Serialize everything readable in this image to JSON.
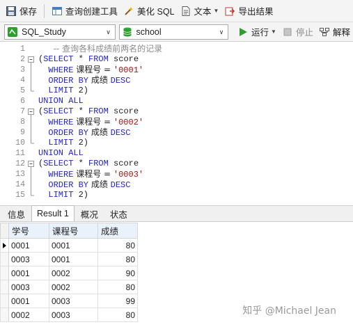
{
  "toolbar": {
    "save": "保存",
    "query_builder": "查询创建工具",
    "beautify_sql": "美化 SQL",
    "text": "文本",
    "export_results": "导出结果"
  },
  "connection_bar": {
    "connection": "SQL_Study",
    "database": "school",
    "run": "运行",
    "stop": "停止",
    "explain": "解释"
  },
  "editor": {
    "lines": [
      {
        "n": "1",
        "indent": 3,
        "parts": [
          {
            "t": "-- 查询各科成绩前两名的记录",
            "c": "cm"
          }
        ]
      },
      {
        "n": "2",
        "indent": 0,
        "fold": "open",
        "parts": [
          {
            "t": "(",
            "c": ""
          },
          {
            "t": "SELECT",
            "c": "kw"
          },
          {
            "t": " * ",
            "c": ""
          },
          {
            "t": "FROM",
            "c": "kw"
          },
          {
            "t": " score",
            "c": ""
          }
        ]
      },
      {
        "n": "3",
        "indent": 2,
        "fold": "bar",
        "parts": [
          {
            "t": "WHERE",
            "c": "kw"
          },
          {
            "t": " 课程号 = ",
            "c": ""
          },
          {
            "t": "'0001'",
            "c": "str"
          }
        ]
      },
      {
        "n": "4",
        "indent": 2,
        "fold": "bar",
        "parts": [
          {
            "t": "ORDER BY",
            "c": "kw"
          },
          {
            "t": " 成绩 ",
            "c": ""
          },
          {
            "t": "DESC",
            "c": "kw"
          }
        ]
      },
      {
        "n": "5",
        "indent": 2,
        "fold": "end",
        "parts": [
          {
            "t": "LIMIT",
            "c": "kw"
          },
          {
            "t": " 2)",
            "c": ""
          }
        ]
      },
      {
        "n": "6",
        "indent": 0,
        "parts": [
          {
            "t": "UNION ALL",
            "c": "kw"
          }
        ]
      },
      {
        "n": "7",
        "indent": 0,
        "fold": "open",
        "parts": [
          {
            "t": "(",
            "c": ""
          },
          {
            "t": "SELECT",
            "c": "kw"
          },
          {
            "t": " * ",
            "c": ""
          },
          {
            "t": "FROM",
            "c": "kw"
          },
          {
            "t": " score",
            "c": ""
          }
        ]
      },
      {
        "n": "8",
        "indent": 2,
        "fold": "bar",
        "parts": [
          {
            "t": "WHERE",
            "c": "kw"
          },
          {
            "t": " 课程号 = ",
            "c": ""
          },
          {
            "t": "'0002'",
            "c": "str"
          }
        ]
      },
      {
        "n": "9",
        "indent": 2,
        "fold": "bar",
        "parts": [
          {
            "t": "ORDER BY",
            "c": "kw"
          },
          {
            "t": " 成绩 ",
            "c": ""
          },
          {
            "t": "DESC",
            "c": "kw"
          }
        ]
      },
      {
        "n": "10",
        "indent": 2,
        "fold": "end",
        "parts": [
          {
            "t": "LIMIT",
            "c": "kw"
          },
          {
            "t": " 2)",
            "c": ""
          }
        ]
      },
      {
        "n": "11",
        "indent": 0,
        "parts": [
          {
            "t": "UNION ALL",
            "c": "kw"
          }
        ]
      },
      {
        "n": "12",
        "indent": 0,
        "fold": "open",
        "parts": [
          {
            "t": "(",
            "c": ""
          },
          {
            "t": "SELECT",
            "c": "kw"
          },
          {
            "t": " * ",
            "c": ""
          },
          {
            "t": "FROM",
            "c": "kw"
          },
          {
            "t": " score",
            "c": ""
          }
        ]
      },
      {
        "n": "13",
        "indent": 2,
        "fold": "bar",
        "parts": [
          {
            "t": "WHERE",
            "c": "kw"
          },
          {
            "t": " 课程号 = ",
            "c": ""
          },
          {
            "t": "'0003'",
            "c": "str"
          }
        ]
      },
      {
        "n": "14",
        "indent": 2,
        "fold": "bar",
        "parts": [
          {
            "t": "ORDER BY",
            "c": "kw"
          },
          {
            "t": " 成绩 ",
            "c": ""
          },
          {
            "t": "DESC",
            "c": "kw"
          }
        ]
      },
      {
        "n": "15",
        "indent": 2,
        "fold": "end",
        "parts": [
          {
            "t": "LIMIT",
            "c": "kw"
          },
          {
            "t": " 2)",
            "c": ""
          }
        ]
      }
    ]
  },
  "result_tabs": [
    "信息",
    "Result 1",
    "概况",
    "状态"
  ],
  "active_tab": 1,
  "results": {
    "columns": [
      "学号",
      "课程号",
      "成绩"
    ],
    "rows": [
      [
        "0001",
        "0001",
        "80"
      ],
      [
        "0003",
        "0001",
        "80"
      ],
      [
        "0001",
        "0002",
        "90"
      ],
      [
        "0003",
        "0002",
        "80"
      ],
      [
        "0001",
        "0003",
        "99"
      ],
      [
        "0002",
        "0003",
        "80"
      ]
    ]
  },
  "watermark": "知乎 @Michael Jean",
  "colors": {
    "keyword": "#2424c8",
    "string": "#a31515",
    "comment": "#8c8c8c",
    "run_green": "#2e9e2e",
    "header_bg": "#e9f1fb"
  },
  "icons": [
    "save-icon",
    "query-builder-icon",
    "beautify-sql-icon",
    "text-icon",
    "export-icon",
    "connection-icon",
    "database-icon",
    "run-icon",
    "stop-icon",
    "explain-icon"
  ]
}
